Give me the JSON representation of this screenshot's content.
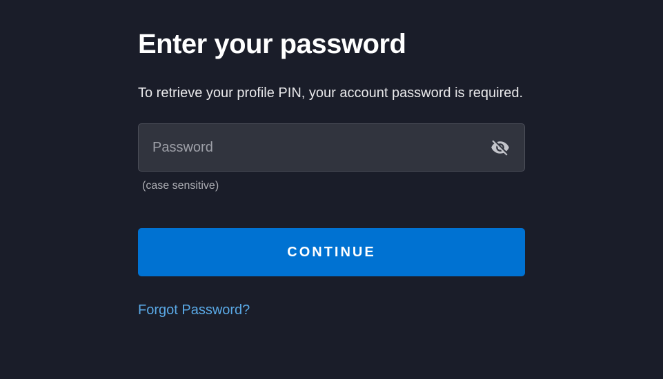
{
  "heading": "Enter your password",
  "subtitle": "To retrieve your profile PIN, your account password is required.",
  "password": {
    "placeholder": "Password",
    "value": "",
    "hint": "(case sensitive)"
  },
  "continue_label": "CONTINUE",
  "forgot_label": "Forgot Password?"
}
